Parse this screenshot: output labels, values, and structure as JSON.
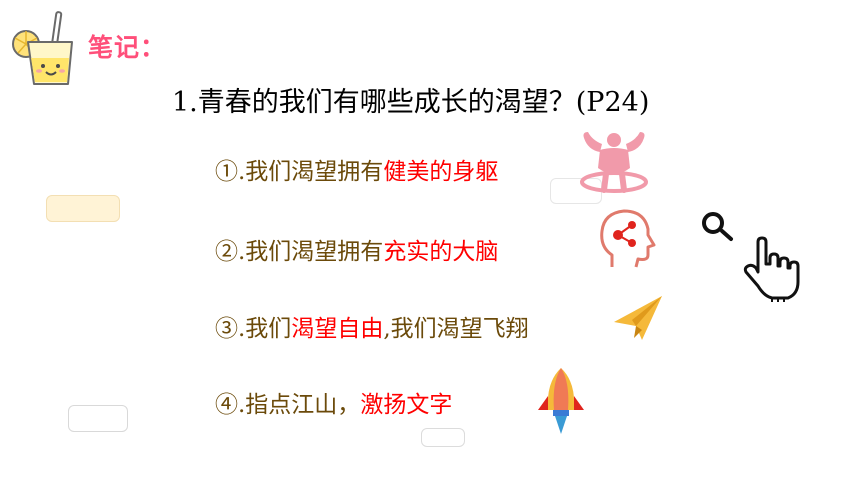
{
  "header": {
    "note_label": "笔记："
  },
  "question": {
    "text": "1.青春的我们有哪些成长的渴望？(P24)"
  },
  "items": [
    {
      "prefix": "①.我们渴望拥有",
      "highlight": "健美的身躯",
      "suffix": ""
    },
    {
      "prefix": "②.我们渴望拥有",
      "highlight": "充实的大脑",
      "suffix": ""
    },
    {
      "prefix": "③.我们",
      "highlight": "渴望自由",
      "suffix": ",我们渴望飞翔"
    },
    {
      "prefix": "④.指点江山，",
      "highlight": "激扬文字",
      "suffix": ""
    }
  ],
  "colors": {
    "note_label": "#ff4f7a",
    "item_text": "#6b4a0a",
    "highlight": "#ff0000",
    "fitness_icon": "#f19aaa",
    "brain_icon": "#e07a6c",
    "plane_icon": "#f5b93a",
    "rocket_icon": "#f07a55"
  },
  "icons": {
    "mascot": "lemonade-cup-icon",
    "item1": "fitness-muscle-icon",
    "item2": "brain-head-icon",
    "item3": "paper-plane-icon",
    "item4": "rocket-icon",
    "cursor_search": "magnifier-icon",
    "cursor_hand": "pointing-hand-icon"
  }
}
